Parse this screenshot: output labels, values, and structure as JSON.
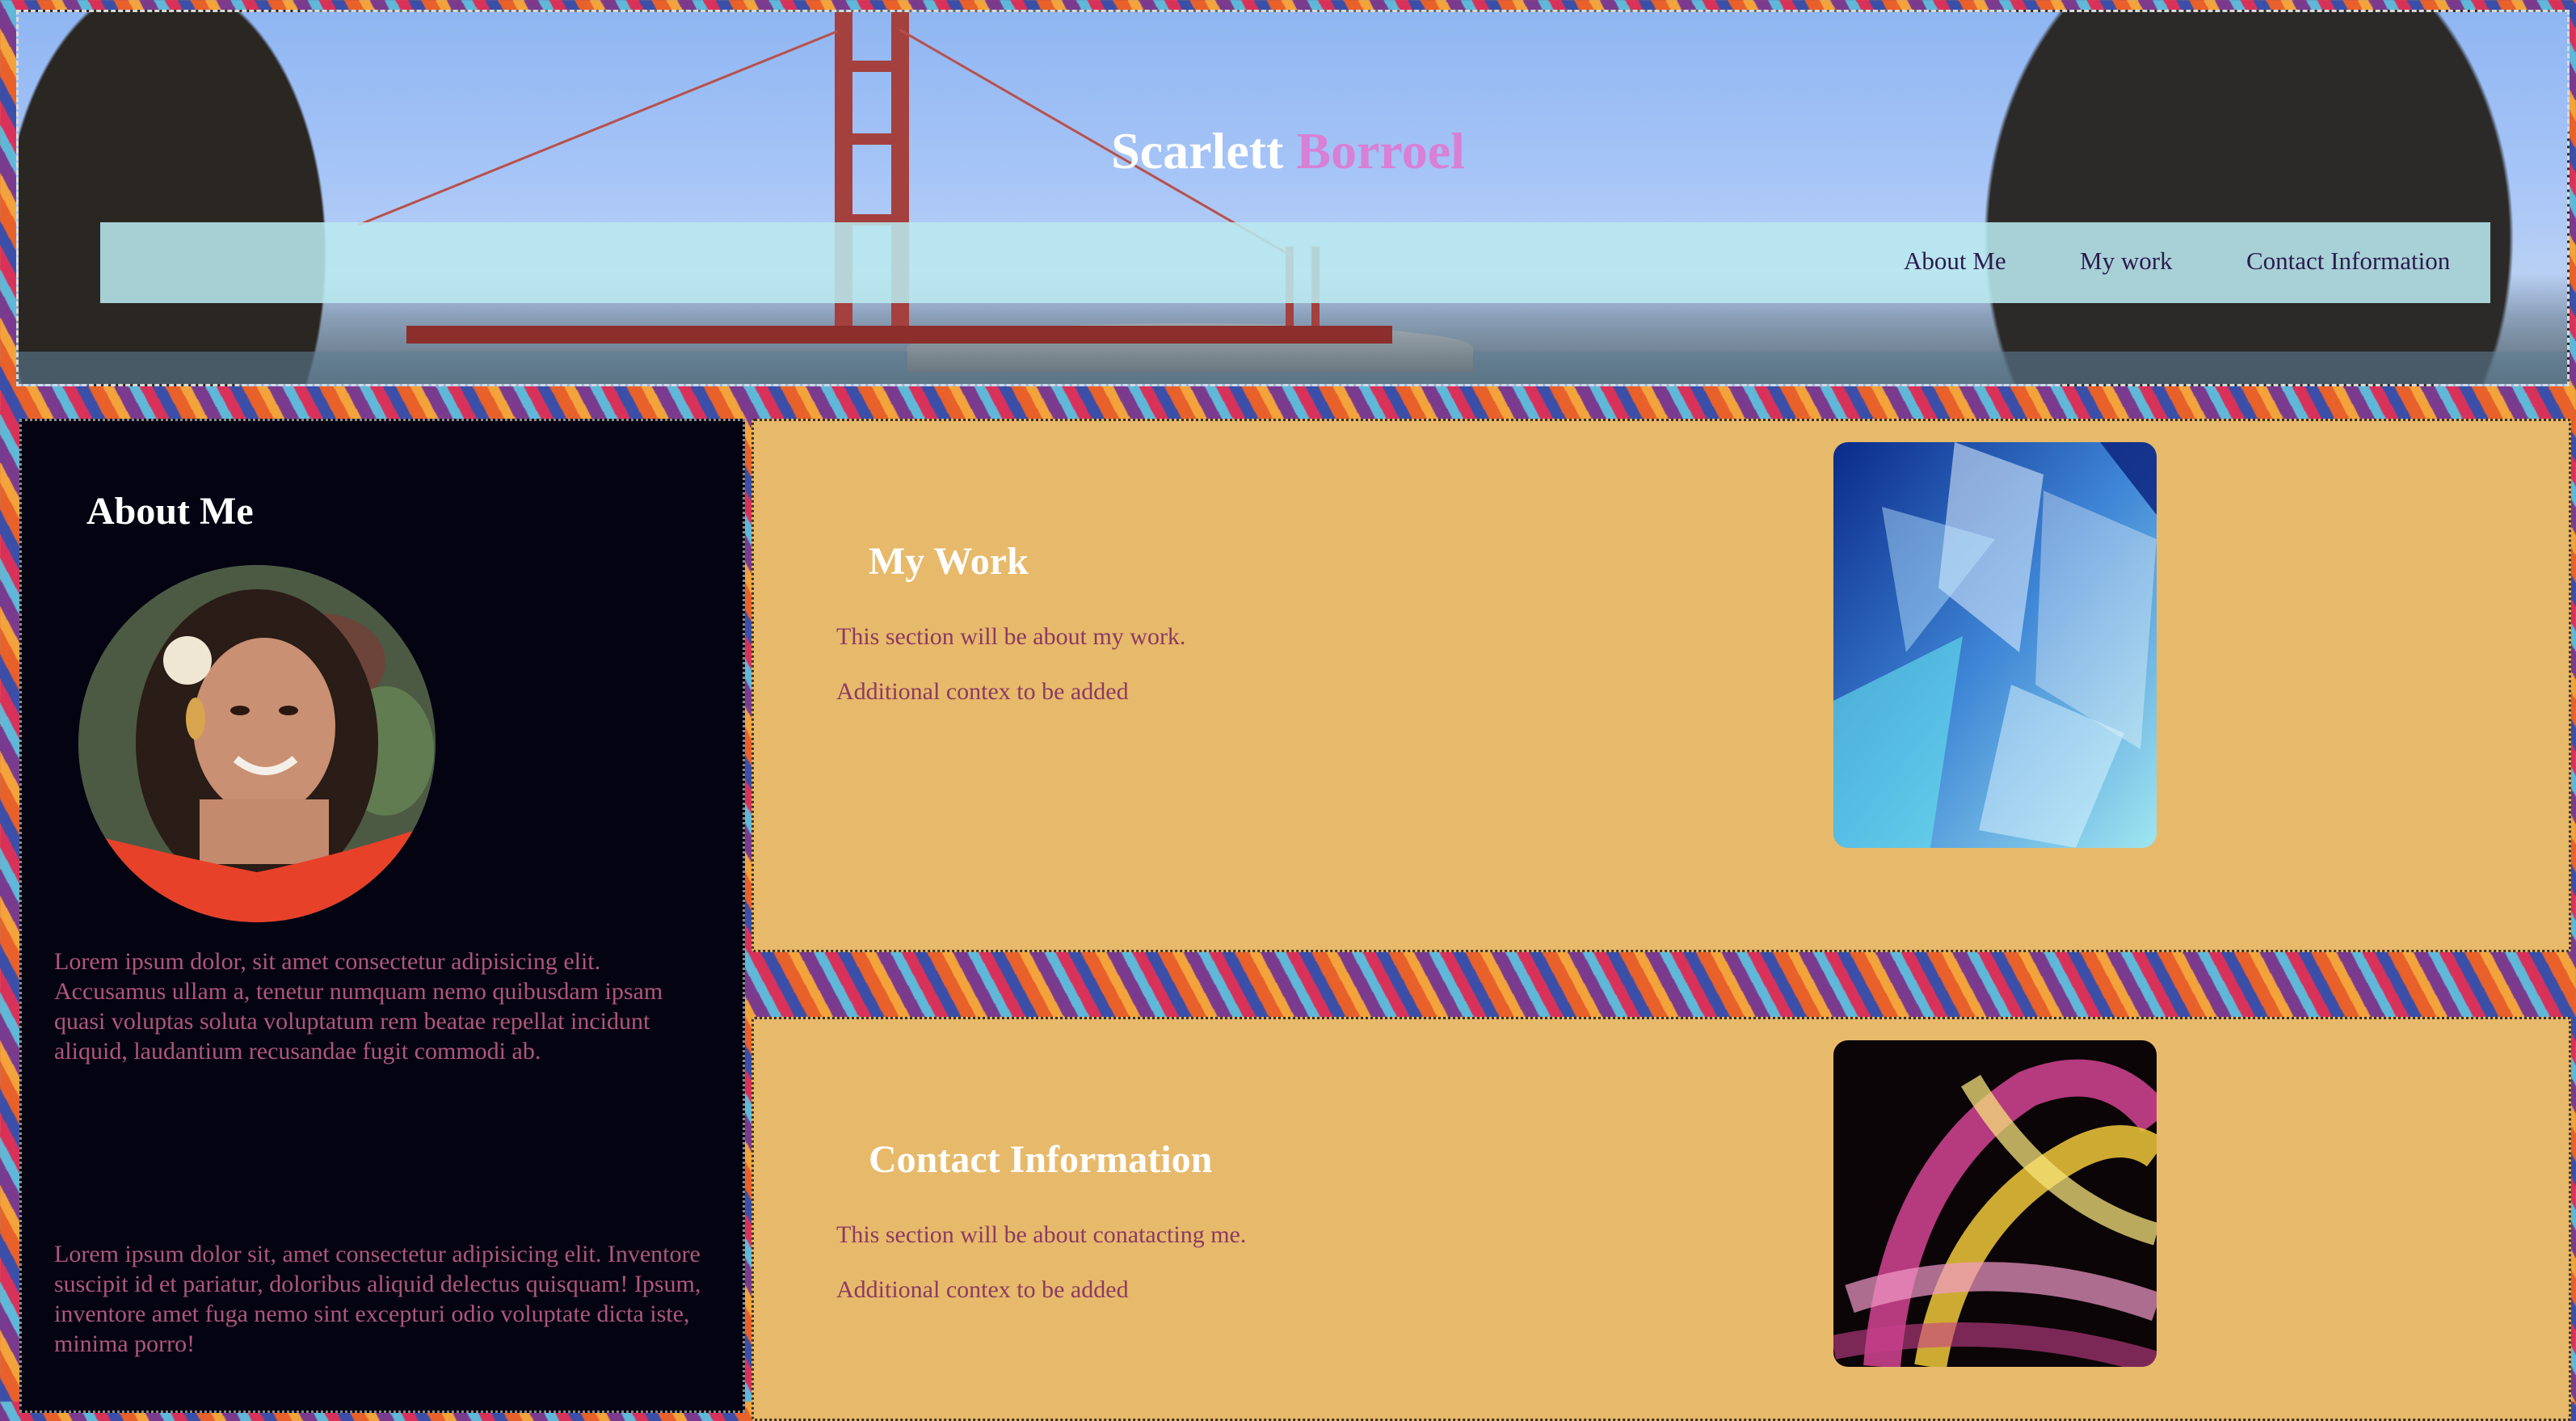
{
  "header": {
    "title_first": "Scarlett",
    "title_last": "Borroel"
  },
  "nav": {
    "items": [
      {
        "label": "About Me"
      },
      {
        "label": "My work"
      },
      {
        "label": "Contact Information"
      }
    ]
  },
  "about": {
    "title": "About Me",
    "paragraph_1": "Lorem ipsum dolor, sit amet consectetur adipisicing elit. Accusamus ullam a, tenetur numquam nemo quibusdam ipsam quasi voluptas soluta voluptatum rem beatae repellat incidunt aliquid, laudantium recusandae fugit commodi ab.",
    "paragraph_2": "Lorem ipsum dolor sit, amet consectetur adipisicing elit. Inventore suscipit id et pariatur, doloribus aliquid delectus quisquam! Ipsum, inventore amet fuga nemo sint excepturi odio voluptate dicta iste, minima porro!"
  },
  "work": {
    "title": "My Work",
    "line_1": "This section will be about my work.",
    "line_2": "Additional contex to be added"
  },
  "contact": {
    "title": "Contact Information",
    "line_1": "This section will be about conatacting me.",
    "line_2": "Additional contex to be added"
  },
  "colors": {
    "name_accent": "#d97fd6",
    "card_bg": "#e7b96a",
    "about_bg": "#030312",
    "nav_bg": "#b8e8ee",
    "body_text": "#b0567c"
  }
}
